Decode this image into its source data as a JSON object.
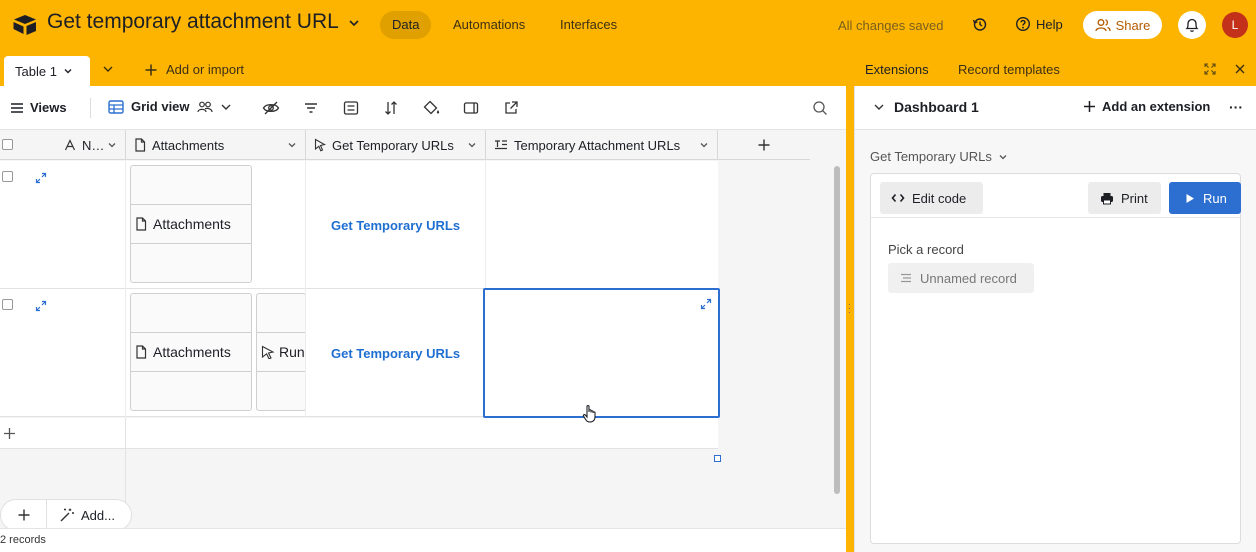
{
  "app": {
    "base_title": "Get temporary attachment URL",
    "tabs": [
      {
        "label": "Data",
        "active": true
      },
      {
        "label": "Automations",
        "active": false
      },
      {
        "label": "Interfaces",
        "active": false
      }
    ],
    "save_status": "All changes saved",
    "help_label": "Help",
    "share_label": "Share",
    "user_initial": "L",
    "brand_color": "#fcb400"
  },
  "table_bar": {
    "table_tab": "Table 1",
    "add_or_import": "Add or import"
  },
  "view_bar": {
    "views_label": "Views",
    "view_name": "Grid view"
  },
  "grid": {
    "columns": [
      {
        "label": "N…",
        "icon": "text-icon"
      },
      {
        "label": "Attachments",
        "icon": "file-icon"
      },
      {
        "label": "Get Temporary URLs",
        "icon": "cursor-icon"
      },
      {
        "label": "Temporary Attachment URLs",
        "icon": "long-text-icon"
      }
    ],
    "rows": [
      {
        "attachments": [
          "Attachments"
        ],
        "button": "Get Temporary URLs",
        "temp_urls": ""
      },
      {
        "attachments": [
          "Attachments",
          "Run"
        ],
        "button": "Get Temporary URLs",
        "temp_urls": ""
      }
    ],
    "add_button_label": "Add...",
    "record_count": "2 records"
  },
  "panel": {
    "tabs": [
      "Extensions",
      "Record templates"
    ],
    "dashboard_title": "Dashboard 1",
    "add_extension_label": "Add an extension",
    "more_label": "···",
    "extension_name": "Get Temporary URLs",
    "edit_code_label": "Edit code",
    "print_label": "Print",
    "run_label": "Run",
    "pick_record_label": "Pick a record",
    "record_placeholder": "Unnamed record",
    "accent_color": "#2d6fd1"
  }
}
